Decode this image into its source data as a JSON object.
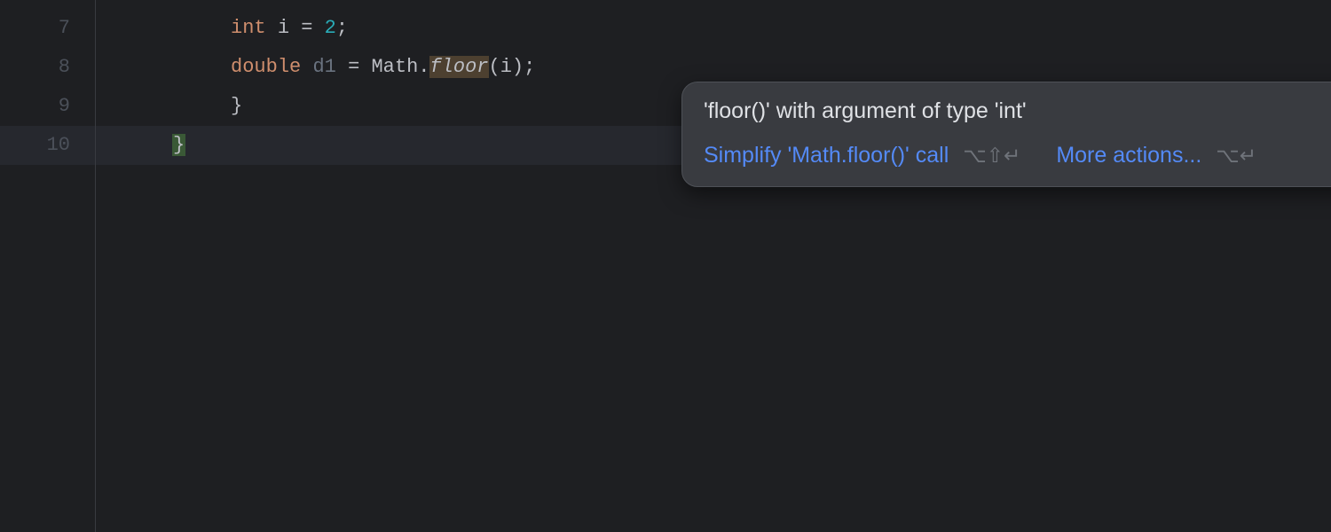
{
  "gutter": {
    "lines": [
      "7",
      "8",
      "9",
      "10"
    ]
  },
  "code": {
    "line7": {
      "indent": "          ",
      "kw": "int",
      "sp1": " ",
      "var": "i",
      "sp2": " ",
      "eq": "=",
      "sp3": " ",
      "num": "2",
      "semi": ";"
    },
    "line8": {
      "indent": "          ",
      "kw": "double",
      "sp1": " ",
      "var": "d1",
      "sp2": " ",
      "eq": "=",
      "sp3": " ",
      "cls": "Math",
      "dot": ".",
      "method": "floor",
      "lparen": "(",
      "arg": "i",
      "rparen": ")",
      "semi": ";"
    },
    "line9": {
      "indent": "          ",
      "brace": "}"
    },
    "line10": {
      "indent": "     ",
      "brace": "}"
    }
  },
  "popup": {
    "title": "'floor()' with argument of type 'int'",
    "simplify_label": "Simplify 'Math.floor()' call",
    "simplify_shortcut": "⌥⇧↵",
    "more_actions_label": "More actions...",
    "more_actions_shortcut": "⌥↵"
  }
}
